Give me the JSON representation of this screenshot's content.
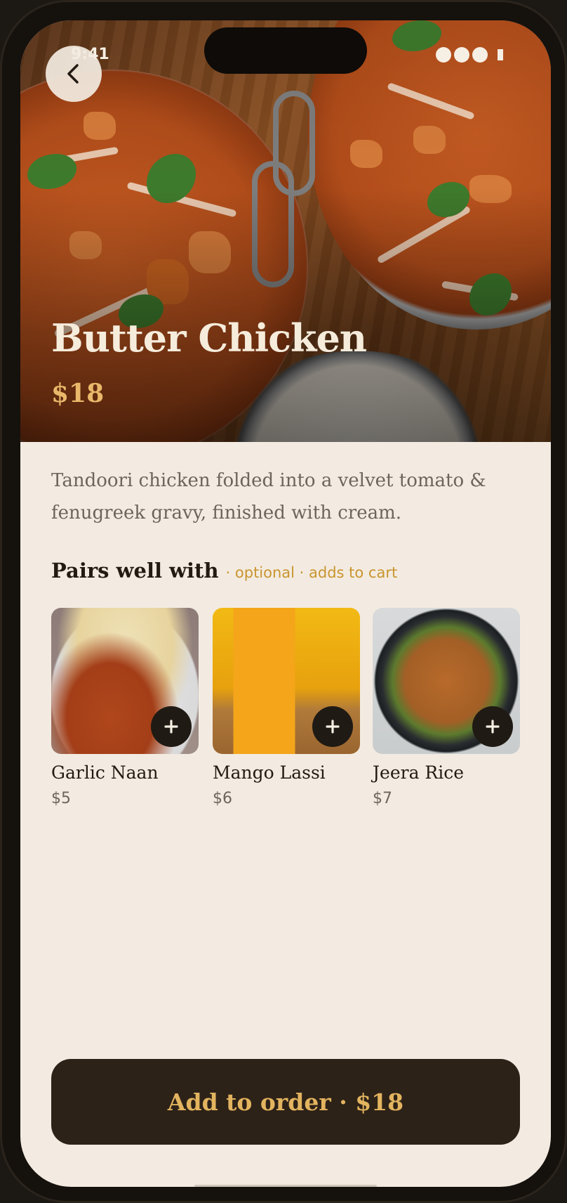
{
  "status_bar": {
    "time": "9:41"
  },
  "dish": {
    "title": "Butter Chicken",
    "price": "$18",
    "description": "Tandoori chicken folded into a velvet tomato & fenugreek gravy, finished with cream."
  },
  "pairs": {
    "title": "Pairs well with",
    "subtitle": "· optional · adds to cart",
    "add_label": "+",
    "items": [
      {
        "name": "Garlic Naan",
        "price": "$5"
      },
      {
        "name": "Mango Lassi",
        "price": "$6"
      },
      {
        "name": "Jeera Rice",
        "price": "$7"
      }
    ]
  },
  "cta": {
    "label": "Add to order · $18"
  },
  "colors": {
    "accent": "#e3b45f",
    "price": "#e9b86a",
    "cta_bg": "#2d2218",
    "page_bg": "#f3ebe1"
  },
  "icons": {
    "back": "chevron-left-icon",
    "add": "plus-icon"
  }
}
